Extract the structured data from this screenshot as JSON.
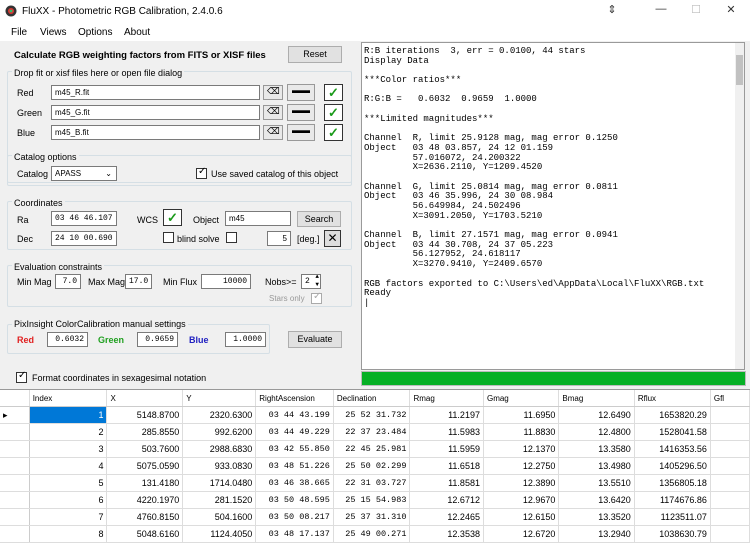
{
  "window": {
    "title": "FluXX - Photometric RGB Calibration, 2.4.0.6",
    "icons": [
      "app-icon",
      "pin-icon",
      "minimize-icon",
      "maximize-icon",
      "close-icon"
    ]
  },
  "menu": [
    "File",
    "Views",
    "Options",
    "About"
  ],
  "header": {
    "heading": "Calculate RGB weighting factors from FITS or XISF files",
    "reset": "Reset"
  },
  "files": {
    "label": "Drop fit or xisf files here or open file dialog",
    "red_label": "Red",
    "red_value": "m45_R.fit",
    "green_label": "Green",
    "green_value": "m45_G.fit",
    "blue_label": "Blue",
    "blue_value": "m45_B.fit",
    "dots": "▬▬"
  },
  "catalog": {
    "group": "Catalog options",
    "label": "Catalog",
    "value": "APASS",
    "use_saved": "Use saved catalog of this object",
    "use_saved_checked": true
  },
  "coords": {
    "group": "Coordinates",
    "ra_label": "Ra",
    "ra_value": "03 46 46.107",
    "dec_label": "Dec",
    "dec_value": "24 10 00.690",
    "wcs_label": "WCS",
    "object_label": "Object",
    "object_value": "m45",
    "search": "Search",
    "blind_solve": "blind solve",
    "blind_checked": false,
    "solve": "solve",
    "solve_checked": false,
    "deg_value": "5",
    "deg_label": "[deg.]"
  },
  "eval": {
    "group": "Evaluation constraints",
    "min_mag_label": "Min Mag",
    "min_mag": "7.0",
    "max_mag_label": "Max Mag",
    "max_mag": "17.0",
    "min_flux_label": "Min Flux",
    "min_flux": "10000",
    "nobs_label": "Nobs>=",
    "nobs": "2",
    "stars_only": "Stars only"
  },
  "pixinsight": {
    "group": "PixInsight ColorCalibration manual settings",
    "red_label": "Red",
    "red_value": "0.6032",
    "green_label": "Green",
    "green_value": "0.9659",
    "blue_label": "Blue",
    "blue_value": "1.0000",
    "evaluate": "Evaluate",
    "colors": {
      "red": "#e02020",
      "green": "#20a020",
      "blue": "#2020c0"
    }
  },
  "format_sexagesimal": {
    "label": "Format coordinates in sexagesimal notation",
    "checked": true
  },
  "console_lines": [
    "R:B iterations  3, err = 0.0100, 44 stars",
    "Display Data",
    "",
    "***Color ratios***",
    "",
    "R:G:B =   0.6032  0.9659  1.0000",
    "",
    "***Limited magnitudes***",
    "",
    "Channel  R, limit 25.9128 mag, mag error 0.1250",
    "Object   03 48 03.857, 24 12 01.159",
    "         57.016072, 24.200322",
    "         X=2636.2110, Y=1209.4520",
    "",
    "Channel  G, limit 25.0814 mag, mag error 0.0811",
    "Object   03 46 35.996, 24 30 08.984",
    "         56.649984, 24.502496",
    "         X=3091.2050, Y=1703.5210",
    "",
    "Channel  B, limit 27.1571 mag, mag error 0.0941",
    "Object   03 44 30.708, 24 37 05.223",
    "         56.127952, 24.618117",
    "         X=3270.9410, Y=2409.6570",
    "",
    "RGB factors exported to C:\\Users\\ed\\AppData\\Local\\FluXX\\RGB.txt",
    "Ready",
    "|"
  ],
  "progress": 1.0,
  "grid": {
    "columns": [
      "Index",
      "X",
      "Y",
      "RightAscension",
      "Declination",
      "Rmag",
      "Gmag",
      "Bmag",
      "Rflux",
      "Gfl"
    ],
    "rows": [
      [
        "1",
        "5148.8700",
        "2320.6300",
        "03 44 43.199",
        "25 52 31.732",
        "11.2197",
        "11.6950",
        "12.6490",
        "1653820.29"
      ],
      [
        "2",
        "285.8550",
        "992.6200",
        "03 44 49.229",
        "22 37 23.484",
        "11.5983",
        "11.8830",
        "12.4800",
        "1528041.58"
      ],
      [
        "3",
        "503.7600",
        "2988.6830",
        "03 42 55.850",
        "22 45 25.981",
        "11.5959",
        "12.1370",
        "13.3580",
        "1416353.56"
      ],
      [
        "4",
        "5075.0590",
        "933.0830",
        "03 48 51.226",
        "25 50 02.299",
        "11.6518",
        "12.2750",
        "13.4980",
        "1405296.50"
      ],
      [
        "5",
        "131.4180",
        "1714.0480",
        "03 46 38.665",
        "22 31 03.727",
        "11.8581",
        "12.3890",
        "13.5510",
        "1356805.18"
      ],
      [
        "6",
        "4220.1970",
        "281.1520",
        "03 50 48.595",
        "25 15 54.983",
        "12.6712",
        "12.9670",
        "13.6420",
        "1174676.86"
      ],
      [
        "7",
        "4760.8150",
        "504.1600",
        "03 50 08.217",
        "25 37 31.310",
        "12.2465",
        "12.6150",
        "13.3520",
        "1123511.07"
      ],
      [
        "8",
        "5048.6160",
        "1124.4050",
        "03 48 17.137",
        "25 49 00.271",
        "12.3538",
        "12.6720",
        "13.2940",
        "1038630.79"
      ]
    ]
  }
}
